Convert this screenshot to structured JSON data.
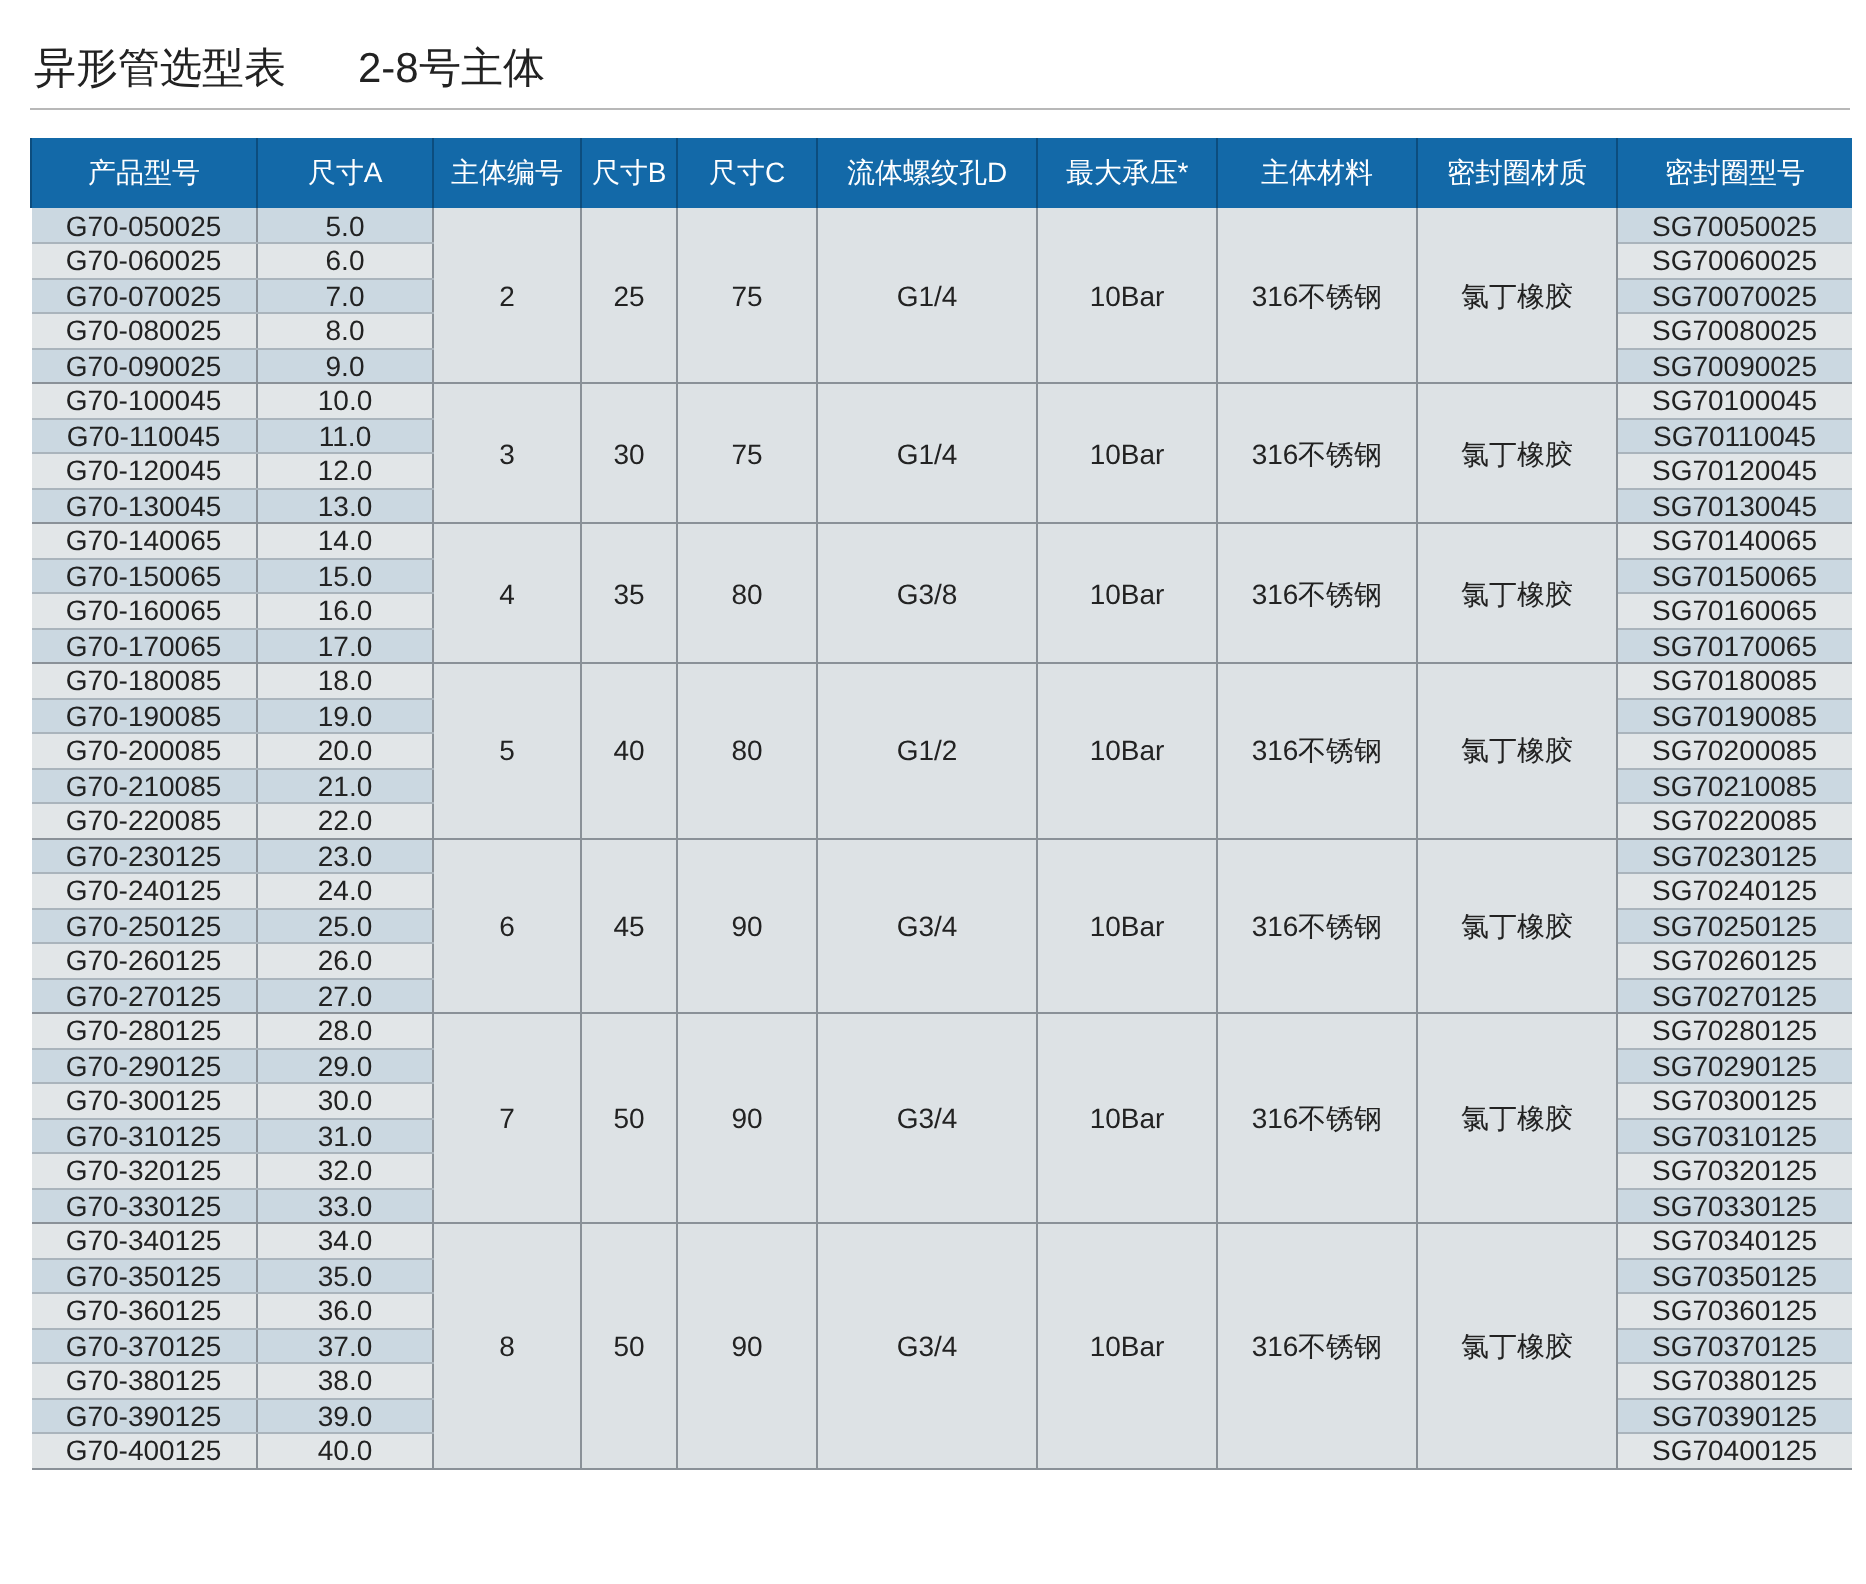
{
  "title": {
    "main": "异形管选型表",
    "sub": "2-8号主体"
  },
  "columns": [
    "产品型号",
    "尺寸A",
    "主体编号",
    "尺寸B",
    "尺寸C",
    "流体螺纹孔D",
    "最大承压*",
    "主体材料",
    "密封圈材质",
    "密封圈型号"
  ],
  "groups": [
    {
      "body_no": "2",
      "size_b": "25",
      "size_c": "75",
      "thread_d": "G1/4",
      "max_pressure": "10Bar",
      "body_material": "316不锈钢",
      "seal_material": "氯丁橡胶",
      "rows": [
        {
          "model": "G70-050025",
          "size_a": "5.0",
          "seal_model": "SG70050025"
        },
        {
          "model": "G70-060025",
          "size_a": "6.0",
          "seal_model": "SG70060025"
        },
        {
          "model": "G70-070025",
          "size_a": "7.0",
          "seal_model": "SG70070025"
        },
        {
          "model": "G70-080025",
          "size_a": "8.0",
          "seal_model": "SG70080025"
        },
        {
          "model": "G70-090025",
          "size_a": "9.0",
          "seal_model": "SG70090025"
        }
      ]
    },
    {
      "body_no": "3",
      "size_b": "30",
      "size_c": "75",
      "thread_d": "G1/4",
      "max_pressure": "10Bar",
      "body_material": "316不锈钢",
      "seal_material": "氯丁橡胶",
      "rows": [
        {
          "model": "G70-100045",
          "size_a": "10.0",
          "seal_model": "SG70100045"
        },
        {
          "model": "G70-110045",
          "size_a": "11.0",
          "seal_model": "SG70110045"
        },
        {
          "model": "G70-120045",
          "size_a": "12.0",
          "seal_model": "SG70120045"
        },
        {
          "model": "G70-130045",
          "size_a": "13.0",
          "seal_model": "SG70130045"
        }
      ]
    },
    {
      "body_no": "4",
      "size_b": "35",
      "size_c": "80",
      "thread_d": "G3/8",
      "max_pressure": "10Bar",
      "body_material": "316不锈钢",
      "seal_material": "氯丁橡胶",
      "rows": [
        {
          "model": "G70-140065",
          "size_a": "14.0",
          "seal_model": "SG70140065"
        },
        {
          "model": "G70-150065",
          "size_a": "15.0",
          "seal_model": "SG70150065"
        },
        {
          "model": "G70-160065",
          "size_a": "16.0",
          "seal_model": "SG70160065"
        },
        {
          "model": "G70-170065",
          "size_a": "17.0",
          "seal_model": "SG70170065"
        }
      ]
    },
    {
      "body_no": "5",
      "size_b": "40",
      "size_c": "80",
      "thread_d": "G1/2",
      "max_pressure": "10Bar",
      "body_material": "316不锈钢",
      "seal_material": "氯丁橡胶",
      "rows": [
        {
          "model": "G70-180085",
          "size_a": "18.0",
          "seal_model": "SG70180085"
        },
        {
          "model": "G70-190085",
          "size_a": "19.0",
          "seal_model": "SG70190085"
        },
        {
          "model": "G70-200085",
          "size_a": "20.0",
          "seal_model": "SG70200085"
        },
        {
          "model": "G70-210085",
          "size_a": "21.0",
          "seal_model": "SG70210085"
        },
        {
          "model": "G70-220085",
          "size_a": "22.0",
          "seal_model": "SG70220085"
        }
      ]
    },
    {
      "body_no": "6",
      "size_b": "45",
      "size_c": "90",
      "thread_d": "G3/4",
      "max_pressure": "10Bar",
      "body_material": "316不锈钢",
      "seal_material": "氯丁橡胶",
      "rows": [
        {
          "model": "G70-230125",
          "size_a": "23.0",
          "seal_model": "SG70230125"
        },
        {
          "model": "G70-240125",
          "size_a": "24.0",
          "seal_model": "SG70240125"
        },
        {
          "model": "G70-250125",
          "size_a": "25.0",
          "seal_model": "SG70250125"
        },
        {
          "model": "G70-260125",
          "size_a": "26.0",
          "seal_model": "SG70260125"
        },
        {
          "model": "G70-270125",
          "size_a": "27.0",
          "seal_model": "SG70270125"
        }
      ]
    },
    {
      "body_no": "7",
      "size_b": "50",
      "size_c": "90",
      "thread_d": "G3/4",
      "max_pressure": "10Bar",
      "body_material": "316不锈钢",
      "seal_material": "氯丁橡胶",
      "rows": [
        {
          "model": "G70-280125",
          "size_a": "28.0",
          "seal_model": "SG70280125"
        },
        {
          "model": "G70-290125",
          "size_a": "29.0",
          "seal_model": "SG70290125"
        },
        {
          "model": "G70-300125",
          "size_a": "30.0",
          "seal_model": "SG70300125"
        },
        {
          "model": "G70-310125",
          "size_a": "31.0",
          "seal_model": "SG70310125"
        },
        {
          "model": "G70-320125",
          "size_a": "32.0",
          "seal_model": "SG70320125"
        },
        {
          "model": "G70-330125",
          "size_a": "33.0",
          "seal_model": "SG70330125"
        }
      ]
    },
    {
      "body_no": "8",
      "size_b": "50",
      "size_c": "90",
      "thread_d": "G3/4",
      "max_pressure": "10Bar",
      "body_material": "316不锈钢",
      "seal_material": "氯丁橡胶",
      "rows": [
        {
          "model": "G70-340125",
          "size_a": "34.0",
          "seal_model": "SG70340125"
        },
        {
          "model": "G70-350125",
          "size_a": "35.0",
          "seal_model": "SG70350125"
        },
        {
          "model": "G70-360125",
          "size_a": "36.0",
          "seal_model": "SG70360125"
        },
        {
          "model": "G70-370125",
          "size_a": "37.0",
          "seal_model": "SG70370125"
        },
        {
          "model": "G70-380125",
          "size_a": "38.0",
          "seal_model": "SG70380125"
        },
        {
          "model": "G70-390125",
          "size_a": "39.0",
          "seal_model": "SG70390125"
        },
        {
          "model": "G70-400125",
          "size_a": "40.0",
          "seal_model": "SG70400125"
        }
      ]
    }
  ]
}
